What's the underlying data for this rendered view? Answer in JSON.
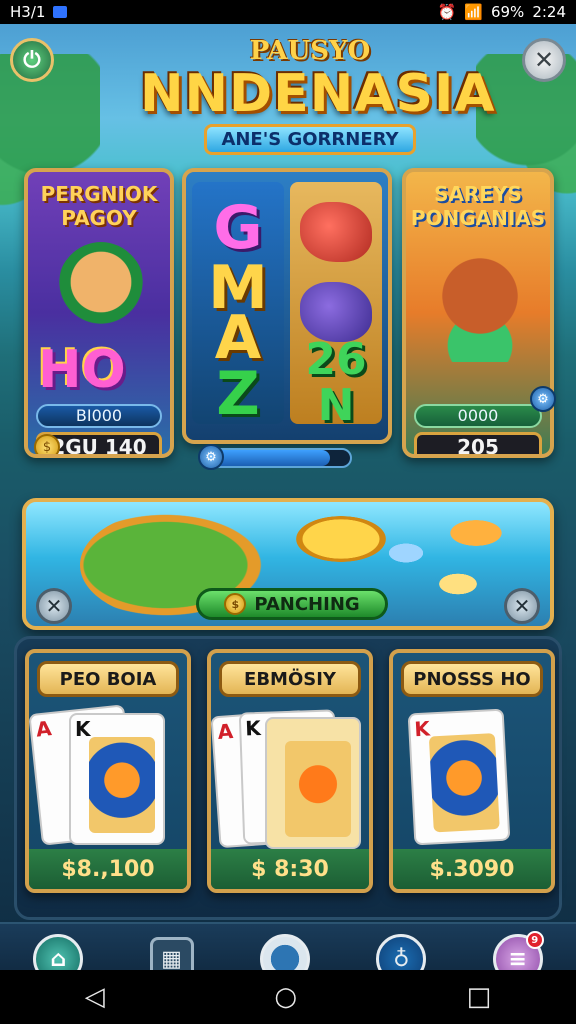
{
  "status_bar": {
    "time_left": "H3/1",
    "battery": "69%",
    "time_right": "2:24"
  },
  "header": {
    "brand_top": "PAUSYO",
    "title": "NNDENASIA",
    "banner": "ANE'S GORRNERY"
  },
  "top_cards": [
    {
      "title": "PERGNIOK PAGOY",
      "big_word": "HO",
      "score": "BI000",
      "value": "2GU 140"
    },
    {
      "letters": [
        "G",
        "M",
        "A",
        "Z"
      ],
      "right_top": "26",
      "right_bottom": "N",
      "progress": 0.86
    },
    {
      "title": "SAREYS PONGANIAS",
      "score": "0000",
      "value": "205"
    }
  ],
  "mid_banner": {
    "button_label": "PANCHING"
  },
  "card_table": [
    {
      "title": "PEO BOIA",
      "rank_red": "A",
      "rank_blk": "K",
      "price": "$8.,100"
    },
    {
      "title": "EBMÖSIY",
      "rank_red": "A",
      "rank_blk": "K",
      "price": "$ 8:30"
    },
    {
      "title": "PNOSSS HO",
      "rank_red": "K",
      "rank_blk": "",
      "price": "$.3090"
    }
  ],
  "nav": {
    "badge_count": "9"
  },
  "icons": {
    "power": "power-icon",
    "close": "close-icon",
    "home": "home-icon",
    "building": "building-icon",
    "ring": "ring-icon",
    "bulb": "bulb-icon",
    "menu": "menu-icon",
    "back": "back-icon",
    "home_android": "android-home-icon",
    "recents": "recents-icon"
  },
  "colors": {
    "accent_gold": "#d6a44e",
    "green_button": "#1e8a2a",
    "price_green": "#2c7f46"
  }
}
